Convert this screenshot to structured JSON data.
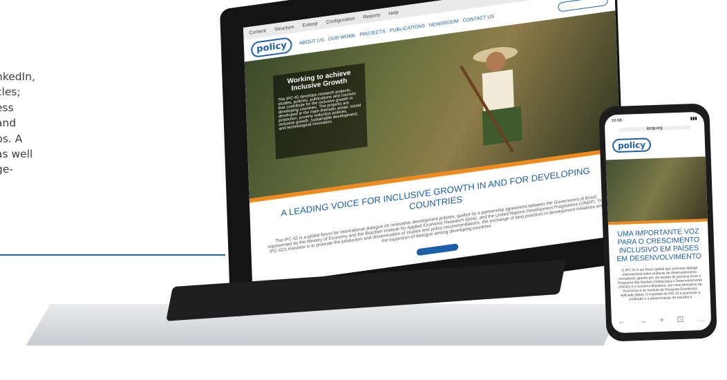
{
  "left_text": {
    "lines": [
      "nkedIn,",
      "cles;",
      "ess",
      "and",
      "ps. A",
      "as well",
      "ge-"
    ]
  },
  "laptop": {
    "toolbar": [
      "Content",
      "Structure",
      "Extend",
      "Configuration",
      "Reports",
      "Help"
    ],
    "nav": [
      "ABOUT US",
      "OUR WORK",
      "PROJECTS",
      "PUBLICATIONS",
      "NEWSROOM",
      "CONTACT US"
    ],
    "logo": "policy",
    "hero_title": "Working to achieve Inclusive Growth",
    "hero_text": "The IPC-IG develops research projects, studies, policies, publications and courses that contribute for the inclusive growth in developing countries. The projects are developed in the main thematic areas: social protection, poverty reduction policies, inclusive growth, sustainable development, and technological innovation.",
    "heading": "A LEADING VOICE FOR INCLUSIVE GROWTH IN AND FOR DEVELOPING COUNTRIES",
    "body": "The IPC-IG is a global forum for international dialogue on innovative development policies, guided by a partnership agreement between the Government of Brazil, represented by the Ministry of Economy and the Brazilian Institute for Applied Economic Research (Ipea), and the United Nations Development Programme (UNDP). The IPC-IG's mandate is to promote the production and dissemination of studies and policy recommendations, the exchange of best practices in development initiatives and the expansion of dialogue among developing countries."
  },
  "phone": {
    "time": "16:08",
    "url": "ipcig.org",
    "logo": "policy",
    "heading": "UMA IMPORTANTE VOZ PARA O CRESCIMENTO INCLUSIVO EM PAÍSES EM DESENVOLVIMENTO",
    "body": "O IPC-IG é um fórum global que promove diálogo internacional sobre políticas de desenvolvimento inovadoras, guiado por um acordo de parceria entre o Programa das Nações Unidas para o Desenvolvimento (PNUD) e o Governo Brasileiro, por meio Ministério da Economia e do Instituto de Pesquisa Econômica Aplicada (Ipea). O mandato do IPC-IG é promover a produção e a disseminação de estudos e",
    "nav": [
      "←",
      "→",
      "+",
      "⊡",
      "…"
    ]
  },
  "colors": {
    "brand": "#1a5fa8",
    "accent": "#f08a1c"
  }
}
